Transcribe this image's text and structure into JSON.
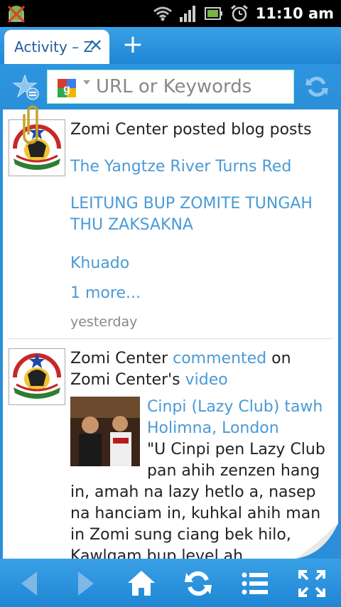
{
  "status_bar": {
    "time": "11:10 am",
    "icons": [
      "android-debug-icon",
      "wifi-icon",
      "signal-icon",
      "battery-icon",
      "alarm-icon"
    ]
  },
  "tabs": [
    {
      "label": "Activity – Zomi Center",
      "active": true
    }
  ],
  "url_bar": {
    "placeholder": "URL or Keywords",
    "search_engine_icon": "google-icon"
  },
  "feed": {
    "entries": [
      {
        "author": "Zomi Center",
        "action": "posted blog posts",
        "posts": [
          "The Yangtze River Turns Red",
          "LEITUNG BUP ZOMITE TUNGAH THU ZAKSAKNA",
          "Khuado"
        ],
        "more": "1 more...",
        "time": "yesterday"
      },
      {
        "author": "Zomi Center",
        "action_link": "commented",
        "on_text": "on Zomi Center's",
        "target_link": "video",
        "video_title": "Cinpi (Lazy Club) tawh Holimna, London",
        "comment_line1": "\"U Cinpi pen Lazy Club",
        "comment_line2": "pan ahih zenzen hang",
        "comment_rest": "in, amah na lazy hetlo a, nasep na hanciam in, kuhkal ahih man in Zomi sung ciang bek hilo, Kawlgam bup level ah"
      }
    ]
  },
  "bottom_bar": {
    "buttons": [
      "back-icon",
      "forward-icon",
      "home-icon",
      "refresh-icon",
      "menu-list-icon",
      "fullscreen-icon"
    ]
  },
  "colors": {
    "accent": "#2a8fd8",
    "link": "#4a9ad6",
    "status_bar": "#000000"
  }
}
